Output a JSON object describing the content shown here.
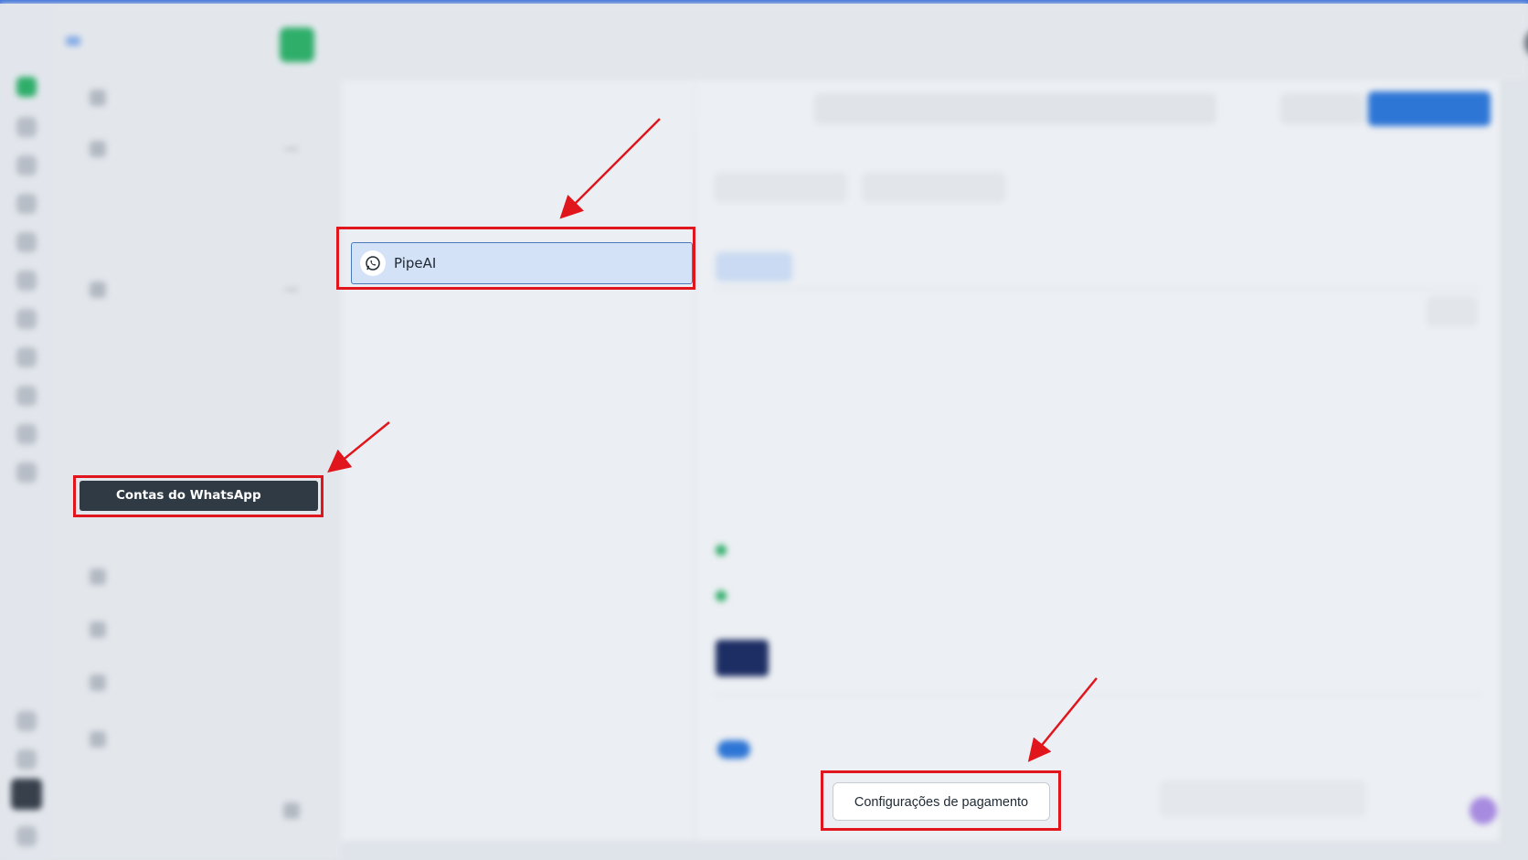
{
  "annotations": {
    "highlight_color": "#e0161c"
  },
  "whatsapp_list": {
    "selected_item_label": "PipeAI",
    "selected_item_icon": "whatsapp-icon"
  },
  "sidebar": {
    "active_item_label": "Contas do WhatsApp"
  },
  "payment": {
    "button_label": "Configurações de pagamento"
  }
}
